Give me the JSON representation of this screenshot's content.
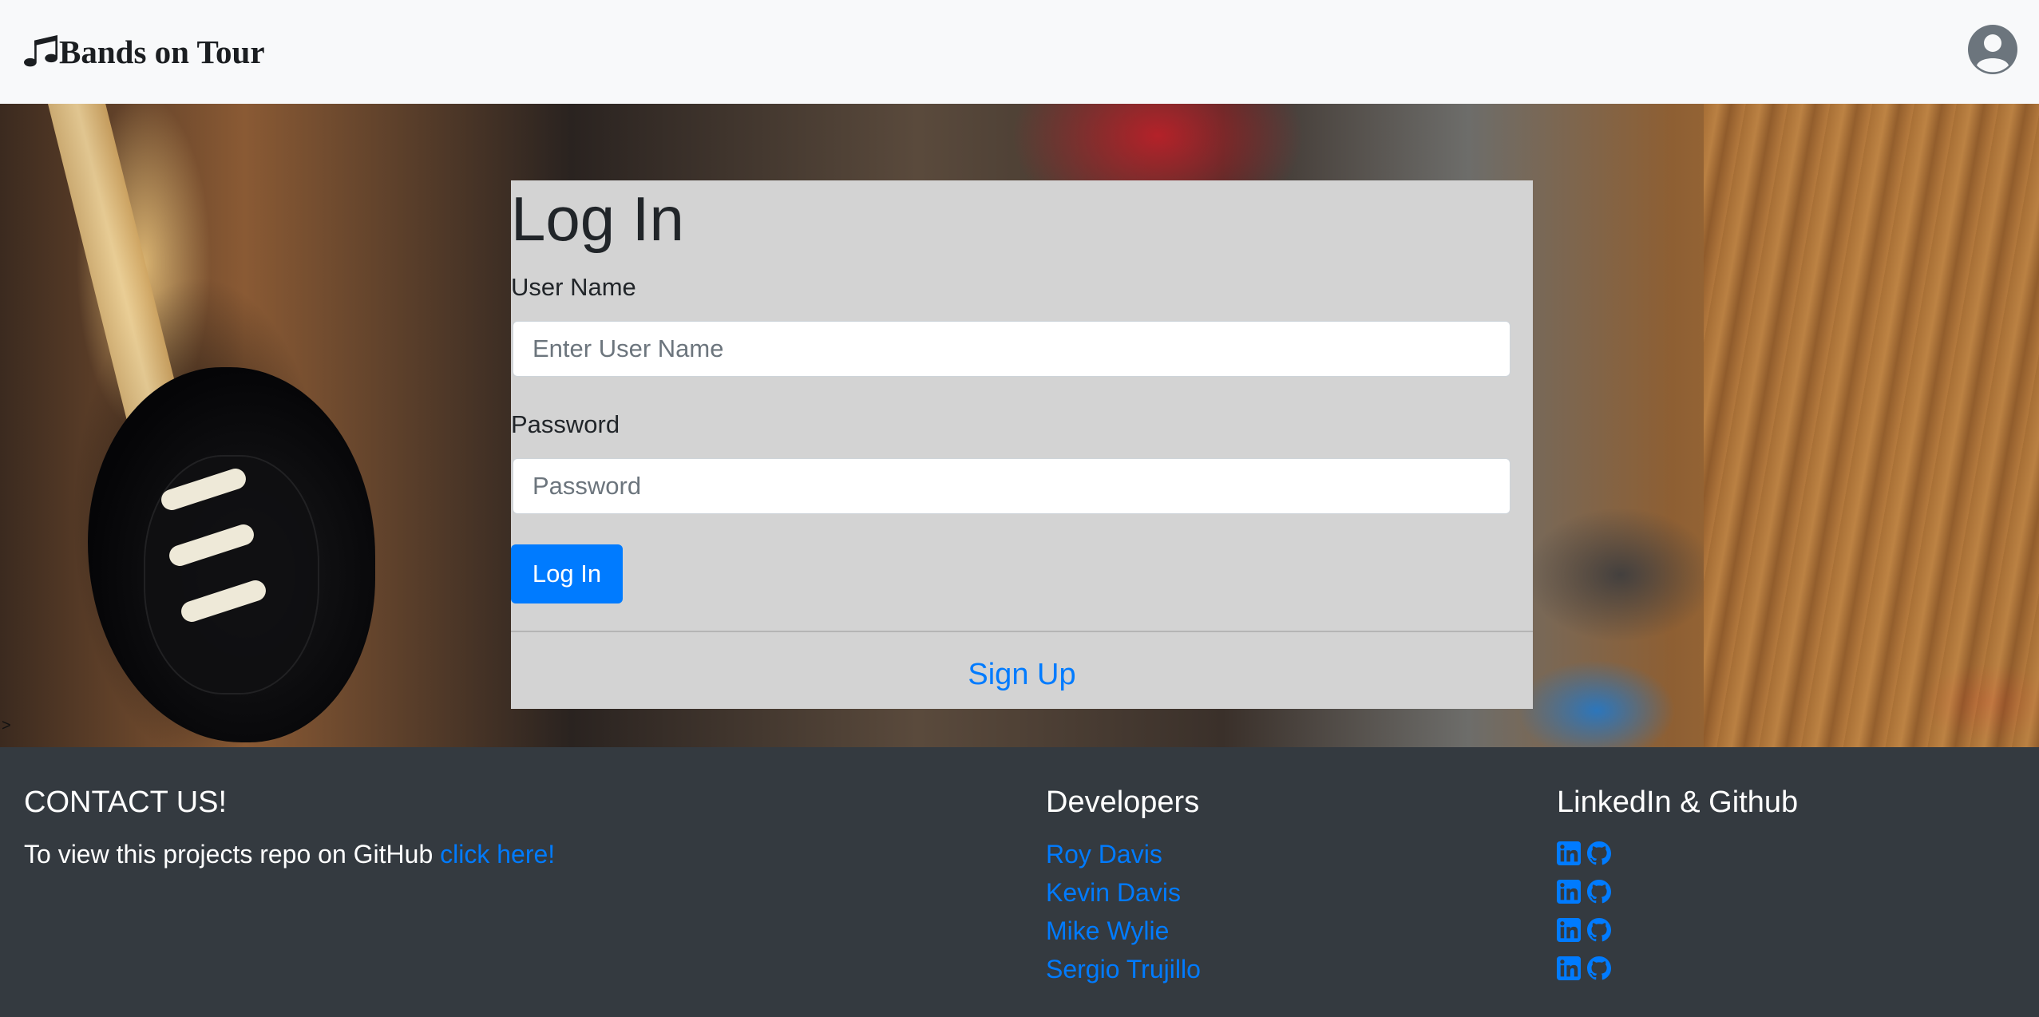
{
  "navbar": {
    "brand": "Bands on Tour",
    "brand_icon": "music-note-icon",
    "user_icon": "user-circle-icon"
  },
  "login": {
    "title": "Log In",
    "username_label": "User Name",
    "username_placeholder": "Enter User Name",
    "password_label": "Password",
    "password_placeholder": "Password",
    "submit_label": "Log In",
    "signup_label": "Sign Up"
  },
  "hero": {
    "caret": ">"
  },
  "footer": {
    "contact_heading": "CONTACT US!",
    "contact_text": "To view this projects repo on GitHub ",
    "contact_link": "click here!",
    "developers_heading": "Developers",
    "developers": [
      {
        "name": "Roy Davis"
      },
      {
        "name": "Kevin Davis"
      },
      {
        "name": "Mike Wylie"
      },
      {
        "name": "Sergio Trujillo"
      }
    ],
    "social_heading": "LinkedIn & Github",
    "social_icons": [
      "linkedin-icon",
      "github-icon"
    ]
  },
  "colors": {
    "accent": "#007bff",
    "navbar_bg": "#f8f9fa",
    "footer_bg": "#343a40",
    "card_bg": "#d3d3d3"
  }
}
